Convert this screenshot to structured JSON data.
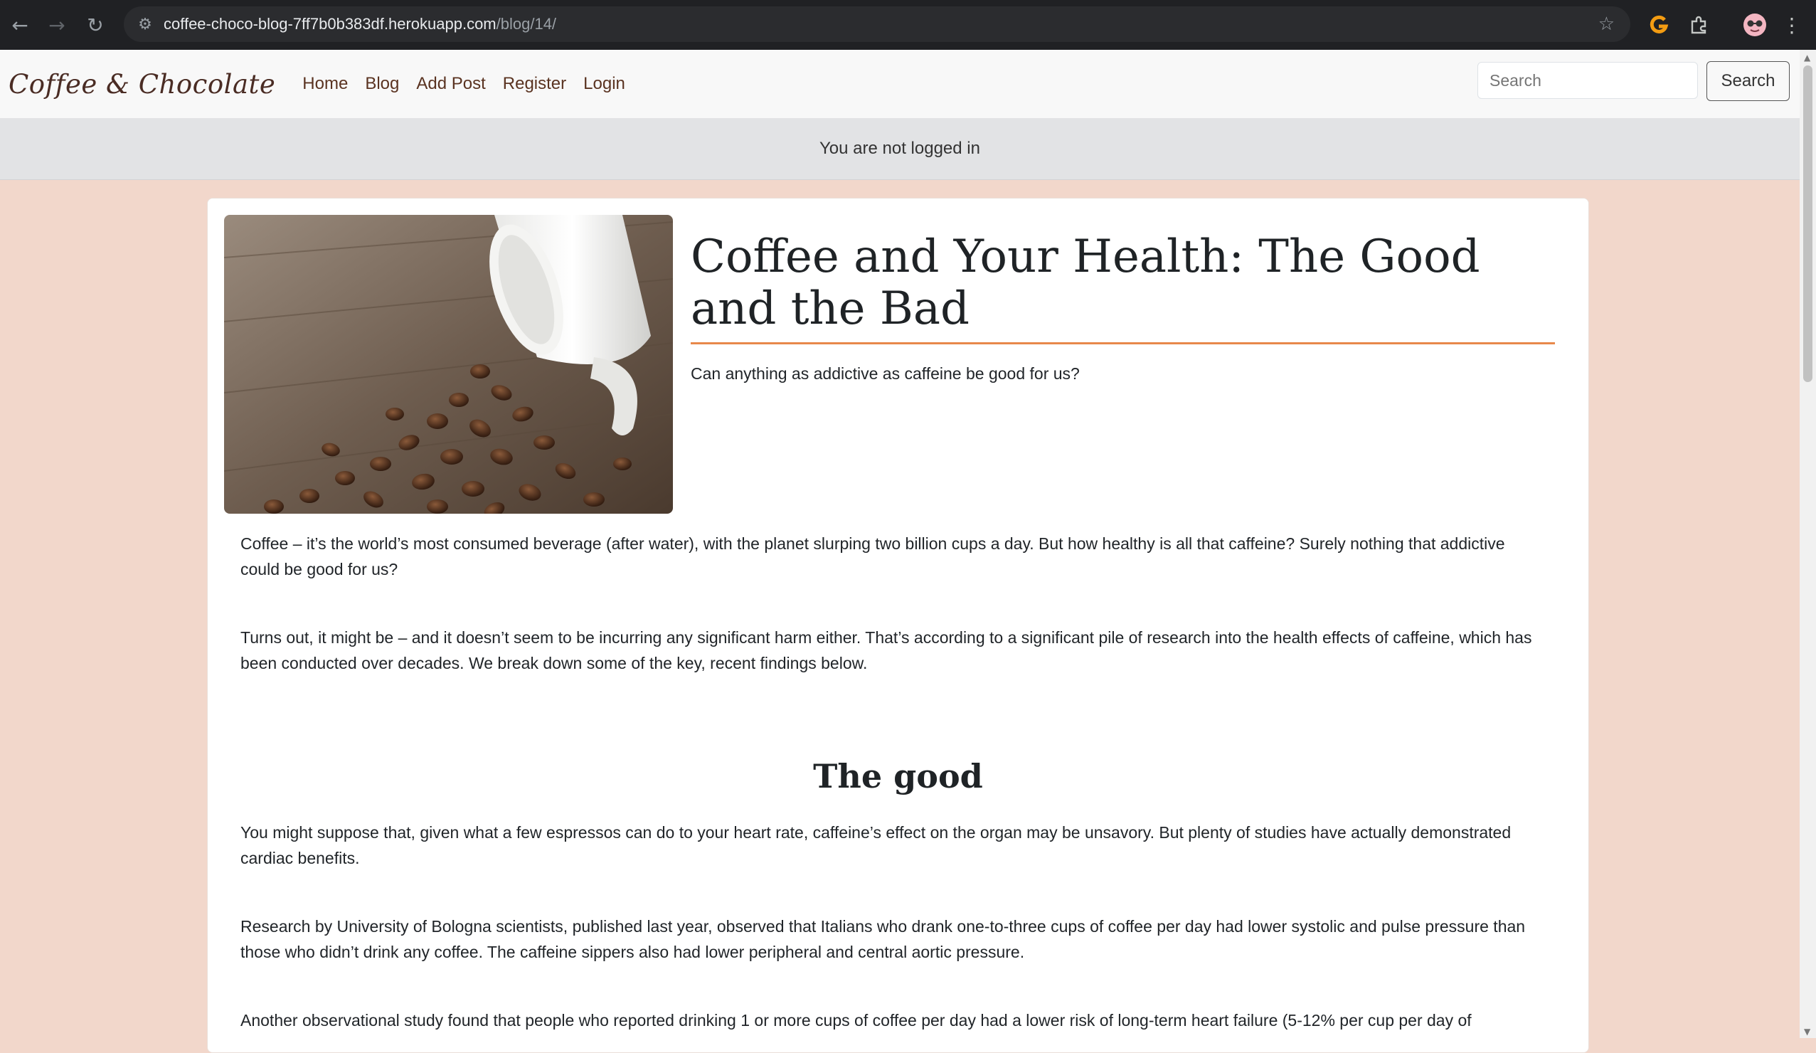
{
  "browser": {
    "url_host": "coffee-choco-blog-7ff7b0b383df.herokuapp.com",
    "url_path": "/blog/14/"
  },
  "site": {
    "brand": "Coffee & Chocolate",
    "nav": [
      "Home",
      "Blog",
      "Add Post",
      "Register",
      "Login"
    ],
    "search_placeholder": "Search",
    "search_button": "Search",
    "status": "You are not logged in"
  },
  "post": {
    "title": "Coffee and Your Health: The Good and the Bad",
    "subtitle": "Can anything as addictive as caffeine be good for us?",
    "paragraphs": [
      "Coffee – it’s the world’s most consumed beverage (after water), with the planet slurping two billion cups a day. But how healthy is all that caffeine? Surely nothing that addictive could be good for us?",
      "Turns out, it might be – and it doesn’t seem to be incurring any significant harm either. That’s according to a significant pile of research into the health effects of caffeine, which has been conducted over decades. We break down some of the key, recent findings below."
    ],
    "section_heading": "The good",
    "section_paragraphs": [
      "You might suppose that, given what a few espressos can do to your heart rate, caffeine’s effect on the organ may be unsavory. But plenty of studies have actually demonstrated cardiac benefits.",
      "Research by University of Bologna scientists, published last year, observed that Italians who drank one-to-three cups of coffee per day had lower systolic and pulse pressure than those who didn’t drink any coffee. The caffeine sippers also had lower peripheral and central aortic pressure.",
      "Another observational study found that people who reported drinking 1 or more cups of coffee per day had a lower risk of long-term heart failure (5-12% per cup per day of"
    ]
  }
}
